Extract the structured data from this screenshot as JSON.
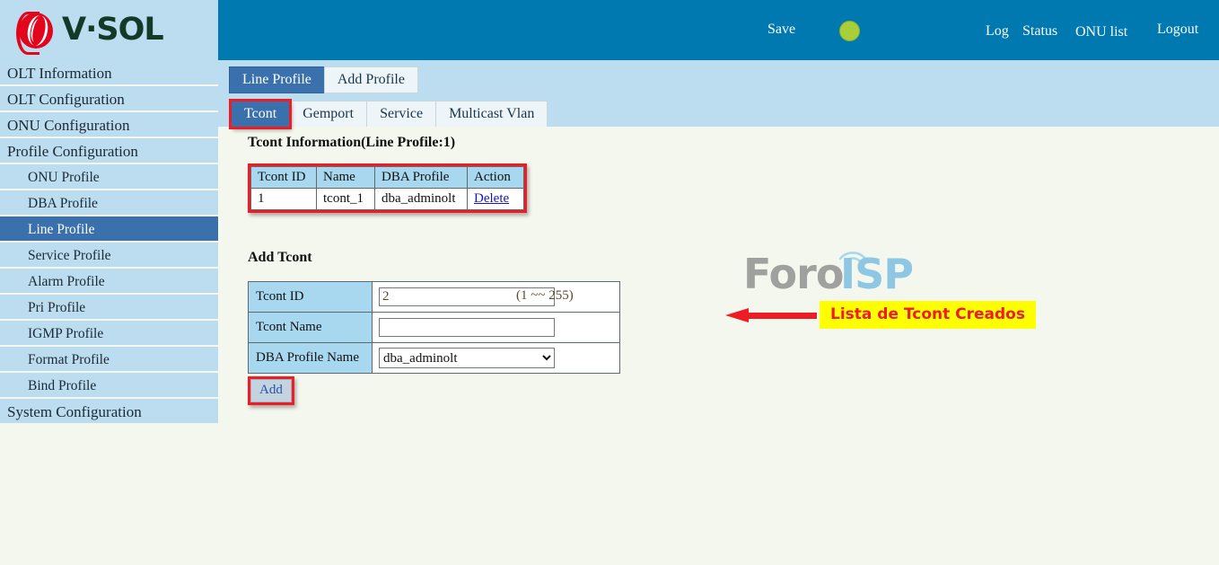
{
  "brand": {
    "logo_text": "V·SOL",
    "logo_icon": "vsol-swirl-logo"
  },
  "topbar": {
    "save_label": "Save",
    "status_indicator_color": "#a8ce3a",
    "log_label": "Log",
    "status_label": "Status",
    "onu_list_label": "ONU list",
    "logout_label": "Logout",
    "background_color": "#0079b0"
  },
  "sidebar": {
    "items": [
      {
        "label": "OLT Information",
        "level": "top",
        "active": false
      },
      {
        "label": "OLT Configuration",
        "level": "top",
        "active": false
      },
      {
        "label": "ONU Configuration",
        "level": "top",
        "active": false
      },
      {
        "label": "Profile Configuration",
        "level": "top",
        "active": false
      },
      {
        "label": "ONU Profile",
        "level": "sub",
        "active": false
      },
      {
        "label": "DBA Profile",
        "level": "sub",
        "active": false
      },
      {
        "label": "Line Profile",
        "level": "sub",
        "active": true
      },
      {
        "label": "Service Profile",
        "level": "sub",
        "active": false
      },
      {
        "label": "Alarm Profile",
        "level": "sub",
        "active": false
      },
      {
        "label": "Pri Profile",
        "level": "sub",
        "active": false
      },
      {
        "label": "IGMP Profile",
        "level": "sub",
        "active": false
      },
      {
        "label": "Format Profile",
        "level": "sub",
        "active": false
      },
      {
        "label": "Bind Profile",
        "level": "sub",
        "active": false
      },
      {
        "label": "System Configuration",
        "level": "top",
        "active": false
      }
    ],
    "item_background": "#bcdcf0",
    "active_background": "#3a71ad"
  },
  "tabs_primary": [
    {
      "label": "Line Profile",
      "active": true,
      "highlighted": false
    },
    {
      "label": "Add Profile",
      "active": false,
      "highlighted": false
    }
  ],
  "tabs_secondary": [
    {
      "label": "Tcont",
      "active": true,
      "highlighted": true
    },
    {
      "label": "Gemport",
      "active": false,
      "highlighted": false
    },
    {
      "label": "Service",
      "active": false,
      "highlighted": false
    },
    {
      "label": "Multicast Vlan",
      "active": false,
      "highlighted": false
    }
  ],
  "info_section": {
    "title": "Tcont Information(Line Profile:1)",
    "columns": [
      "Tcont ID",
      "Name",
      "DBA Profile",
      "Action"
    ],
    "rows": [
      {
        "tcont_id": "1",
        "name": "tcont_1",
        "dba_profile": "dba_adminolt",
        "action": "Delete"
      }
    ],
    "highlight_color": "#ee1c25"
  },
  "annotation": {
    "text": "Lista de Tcont Creados",
    "background": "#ffff00",
    "text_color": "#ee1c25",
    "arrow_color": "#ee1c25",
    "arrow_icon": "left-arrow-icon"
  },
  "add_section": {
    "title": "Add Tcont",
    "fields": {
      "tcont_id_label": "Tcont ID",
      "tcont_id_value": "2",
      "tcont_id_placeholder": "",
      "tcont_id_hint": "(1 ~~ 255)",
      "tcont_name_label": "Tcont Name",
      "tcont_name_value": "",
      "tcont_name_placeholder": "",
      "dba_profile_label": "DBA Profile Name",
      "dba_profile_value": "dba_adminolt",
      "dba_profile_options": [
        "dba_adminolt"
      ]
    },
    "add_button_label": "Add"
  },
  "watermark": {
    "text_primary": "Foro",
    "text_secondary": "ISP",
    "icon": "wifi-signal-icon"
  }
}
